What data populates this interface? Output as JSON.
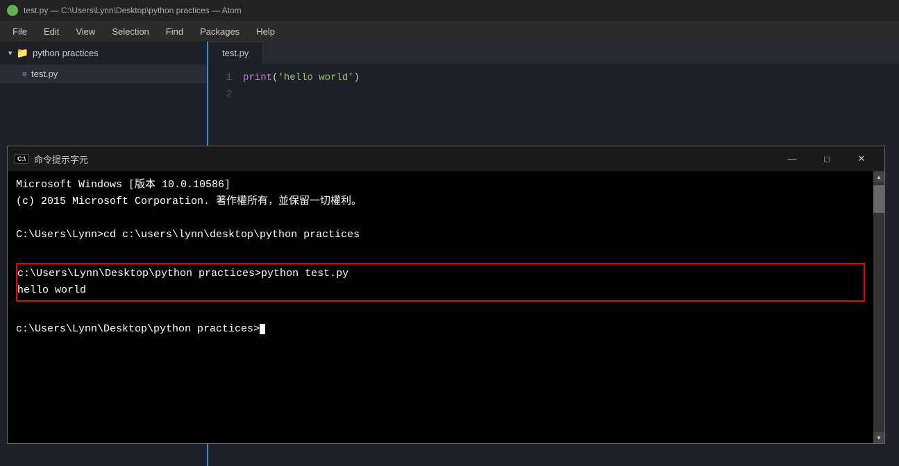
{
  "titleBar": {
    "title": "test.py — C:\\Users\\Lynn\\Desktop\\python practices — Atom"
  },
  "menuBar": {
    "items": [
      "File",
      "Edit",
      "View",
      "Selection",
      "Find",
      "Packages",
      "Help"
    ]
  },
  "sidebar": {
    "folderArrow": "▾",
    "folderName": "python practices",
    "file": {
      "icon": "≡",
      "name": "test.py"
    }
  },
  "editor": {
    "tabName": "test.py",
    "lines": [
      {
        "number": "1",
        "code": "print('hello world')"
      },
      {
        "number": "2",
        "code": ""
      }
    ]
  },
  "cmdWindow": {
    "titleIcon": "C:\\",
    "title": "命令提示字元",
    "controls": {
      "minimize": "—",
      "maximize": "□",
      "close": "✕"
    },
    "lines": [
      "Microsoft Windows [版本 10.0.10586]",
      "(c) 2015 Microsoft Corporation. 著作權所有，並保留一切權利。",
      "",
      "C:\\Users\\Lynn>cd c:\\users\\lynn\\desktop\\python practices",
      ""
    ],
    "highlightedLines": [
      "c:\\Users\\Lynn\\Desktop\\python practices>python test.py",
      "hello world"
    ],
    "afterLines": [
      "",
      "c:\\Users\\Lynn\\Desktop\\python practices>"
    ],
    "scrollUp": "▲",
    "scrollDown": "▼"
  }
}
